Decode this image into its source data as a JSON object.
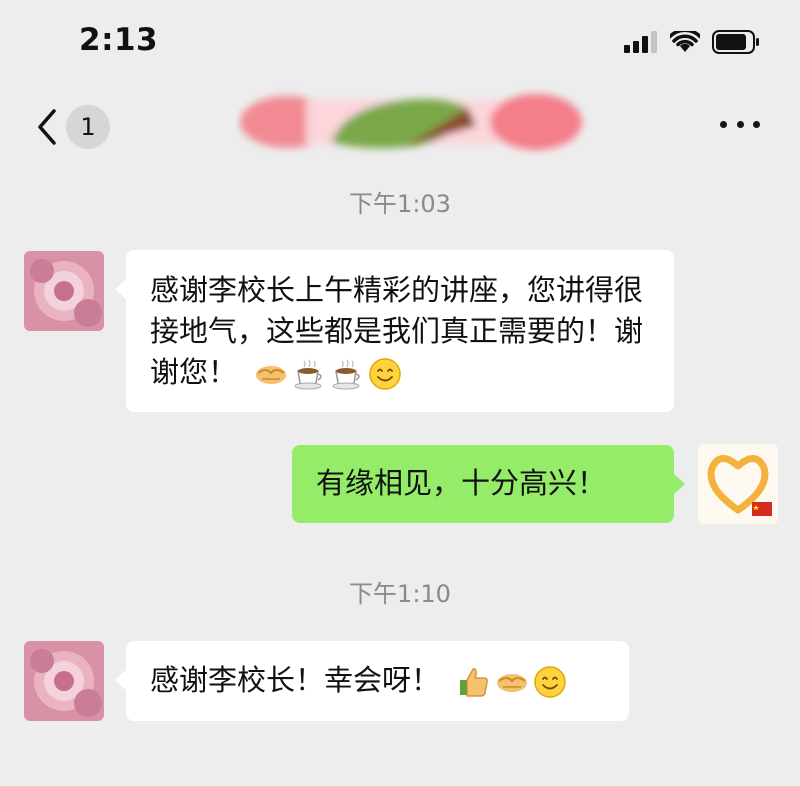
{
  "status_bar": {
    "time": "2:13",
    "icons": [
      "signal-icon",
      "wifi-icon",
      "battery-icon"
    ]
  },
  "nav": {
    "back_icon": "chevron-left-icon",
    "unread_count": "1",
    "more_icon": "ellipsis-icon"
  },
  "messages": [
    {
      "type": "timestamp",
      "text": "下午1:03"
    },
    {
      "type": "incoming",
      "text": "感谢李校长上午精彩的讲座，您讲得很接地气，这些都是我们真正需要的！谢谢您！",
      "emojis": [
        "handshake-emoji",
        "coffee-emoji",
        "coffee-emoji",
        "smile-emoji"
      ]
    },
    {
      "type": "outgoing",
      "text": "有缘相见，十分高兴！"
    },
    {
      "type": "timestamp",
      "text": "下午1:10"
    },
    {
      "type": "incoming",
      "text": "感谢李校长！幸会呀！",
      "emojis": [
        "thumbs-up-emoji",
        "handshake-emoji",
        "smile-emoji"
      ]
    }
  ],
  "colors": {
    "background": "#ededed",
    "incoming_bubble": "#ffffff",
    "outgoing_bubble": "#95ec69",
    "timestamp": "#8a8a8a",
    "badge": "#d6d6d6"
  }
}
